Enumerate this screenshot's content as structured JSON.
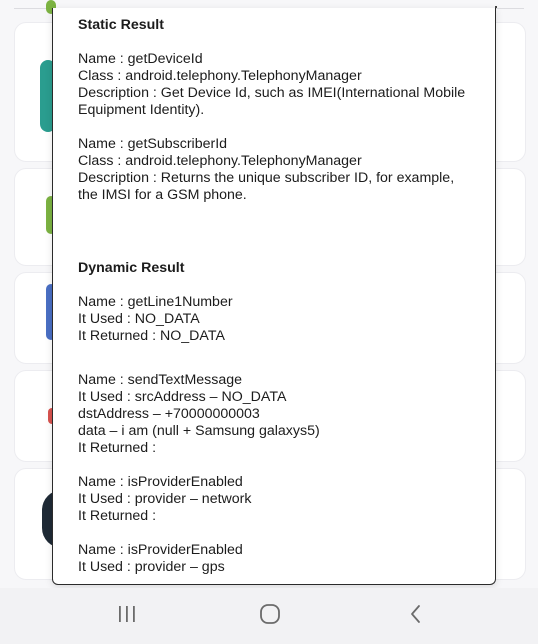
{
  "dialog": {
    "static_section": {
      "title": "Static Result",
      "entries": [
        {
          "name": "Name : getDeviceId",
          "class": "Class : android.telephony.TelephonyManager",
          "description": "Description : Get Device Id, such as IMEI(International Mobile Equipment Identity)."
        },
        {
          "name": "Name : getSubscriberId",
          "class": "Class : android.telephony.TelephonyManager",
          "description": "Description : Returns the unique subscriber ID, for example, the IMSI for a GSM phone."
        }
      ]
    },
    "dynamic_section": {
      "title": "Dynamic Result",
      "entries": [
        {
          "lines": [
            "Name : getLine1Number",
            "It Used : NO_DATA",
            "It Returned : NO_DATA"
          ]
        },
        {
          "lines": [
            "Name : sendTextMessage",
            "It Used : srcAddress – NO_DATA",
            "dstAddress – +70000000003",
            "data – i am (null + Samsung galaxys5)",
            "It Returned :"
          ]
        },
        {
          "lines": [
            "Name : isProviderEnabled",
            "It Used : provider – network",
            "It Returned :"
          ]
        },
        {
          "lines": [
            "Name : isProviderEnabled",
            "It Used : provider – gps"
          ]
        }
      ]
    }
  },
  "navbar": {
    "recents_icon": "recents-icon",
    "home_icon": "home-icon",
    "back_icon": "back-icon"
  },
  "colors": {
    "dialog_border": "#2b2b2b",
    "text": "#1c1c1c",
    "navbar_bg": "#f2f2f4",
    "nav_icon": "#6b6b6b",
    "accent_teal": "#2a9d8f",
    "accent_green": "#7cb342",
    "accent_blue": "#4a6fc4",
    "accent_red": "#d9534f",
    "accent_dark": "#1f2a36"
  }
}
